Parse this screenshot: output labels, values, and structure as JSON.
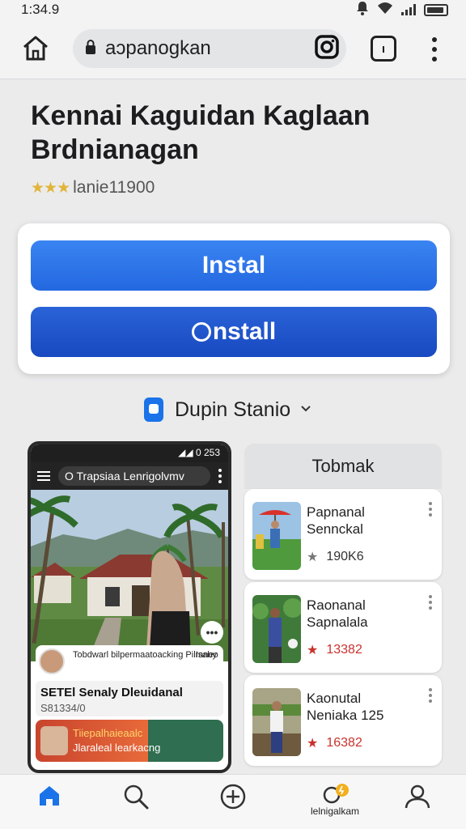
{
  "status_bar": {
    "time": "1:34.9"
  },
  "browser": {
    "url": "aɔpanogkan",
    "tabs_count": "ı"
  },
  "app": {
    "title": "Kennai Kaguidan Kaglaan Brdnianagan",
    "stars": "★★★",
    "rating_text": "lanie11900"
  },
  "install": {
    "primary_label": "Instal",
    "secondary_label": "nstall"
  },
  "device": {
    "name": "Dupin Stanio"
  },
  "preview": {
    "status": "◢◢ 0 253",
    "search_text": "O Trapsiaa Lenrigolvmv",
    "info_line": "Tobdwarl bilpermaatoacking Pilraneo",
    "info_meta": "Isaby",
    "section_title": "SETEl Senaly Dleuidanal",
    "section_sub": "S81334/0",
    "banner_line1": "Tiiepalhaieaalc",
    "banner_line2": "Jlaraleal learkacng"
  },
  "side": {
    "header": "Tobmak",
    "items": [
      {
        "name": "Papnanal Sennckal",
        "count": "190K6",
        "star_color": "#777777"
      },
      {
        "name": "Raonanal Sapnalala",
        "count": "13382",
        "star_color": "#c9322d"
      },
      {
        "name": "Kaonutal Neniaka 125",
        "count": "16382",
        "star_color": "#c9322d"
      }
    ]
  },
  "nav": {
    "notifications_label": "lelnigalkam"
  },
  "colors": {
    "accent": "#1a73e8",
    "primary_button": "#2f78ea",
    "secondary_button": "#1e55cc"
  }
}
